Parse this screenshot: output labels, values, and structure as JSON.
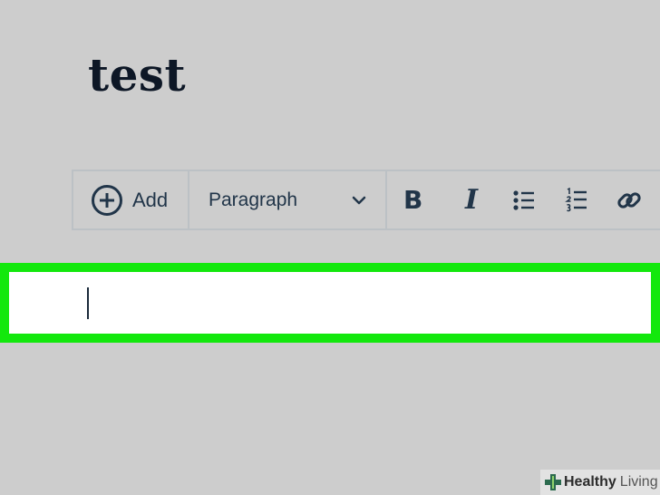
{
  "document": {
    "title": "test"
  },
  "toolbar": {
    "add_label": "Add",
    "format_value": "Paragraph",
    "buttons": [
      "bold",
      "italic",
      "bulleted-list",
      "numbered-list",
      "link"
    ],
    "bold_glyph": "B",
    "italic_glyph": "I"
  },
  "editor": {
    "value": ""
  },
  "watermark": {
    "brand_bold": "Healthy",
    "brand_light": "Living"
  },
  "colors": {
    "highlight": "#13e80d",
    "icon": "#213549",
    "background": "#cdcdcd"
  }
}
